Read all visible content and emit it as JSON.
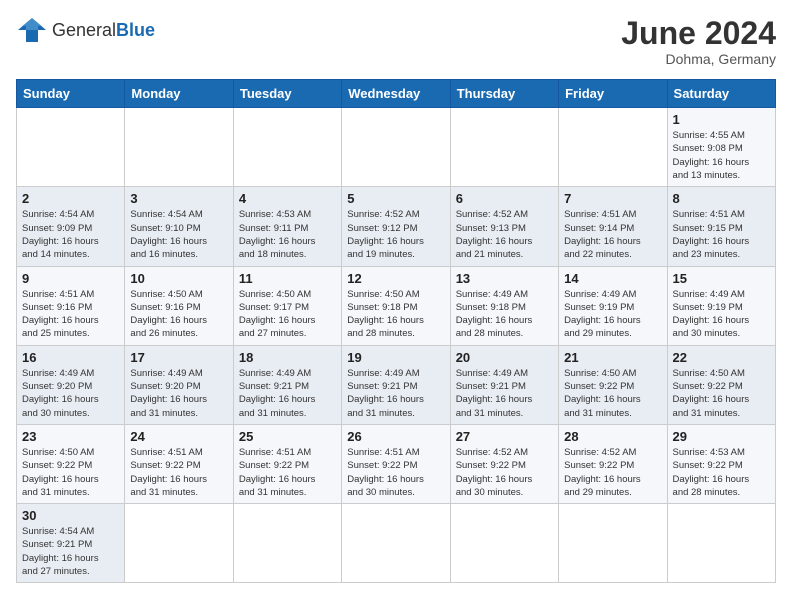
{
  "header": {
    "logo_general": "General",
    "logo_blue": "Blue",
    "month_year": "June 2024",
    "location": "Dohma, Germany"
  },
  "weekdays": [
    "Sunday",
    "Monday",
    "Tuesday",
    "Wednesday",
    "Thursday",
    "Friday",
    "Saturday"
  ],
  "days": [
    {
      "date": "",
      "info": ""
    },
    {
      "date": "",
      "info": ""
    },
    {
      "date": "",
      "info": ""
    },
    {
      "date": "",
      "info": ""
    },
    {
      "date": "",
      "info": ""
    },
    {
      "date": "",
      "info": ""
    },
    {
      "date": "1",
      "info": "Sunrise: 4:55 AM\nSunset: 9:08 PM\nDaylight: 16 hours\nand 13 minutes."
    },
    {
      "date": "2",
      "info": "Sunrise: 4:54 AM\nSunset: 9:09 PM\nDaylight: 16 hours\nand 14 minutes."
    },
    {
      "date": "3",
      "info": "Sunrise: 4:54 AM\nSunset: 9:10 PM\nDaylight: 16 hours\nand 16 minutes."
    },
    {
      "date": "4",
      "info": "Sunrise: 4:53 AM\nSunset: 9:11 PM\nDaylight: 16 hours\nand 18 minutes."
    },
    {
      "date": "5",
      "info": "Sunrise: 4:52 AM\nSunset: 9:12 PM\nDaylight: 16 hours\nand 19 minutes."
    },
    {
      "date": "6",
      "info": "Sunrise: 4:52 AM\nSunset: 9:13 PM\nDaylight: 16 hours\nand 21 minutes."
    },
    {
      "date": "7",
      "info": "Sunrise: 4:51 AM\nSunset: 9:14 PM\nDaylight: 16 hours\nand 22 minutes."
    },
    {
      "date": "8",
      "info": "Sunrise: 4:51 AM\nSunset: 9:15 PM\nDaylight: 16 hours\nand 23 minutes."
    },
    {
      "date": "9",
      "info": "Sunrise: 4:51 AM\nSunset: 9:16 PM\nDaylight: 16 hours\nand 25 minutes."
    },
    {
      "date": "10",
      "info": "Sunrise: 4:50 AM\nSunset: 9:16 PM\nDaylight: 16 hours\nand 26 minutes."
    },
    {
      "date": "11",
      "info": "Sunrise: 4:50 AM\nSunset: 9:17 PM\nDaylight: 16 hours\nand 27 minutes."
    },
    {
      "date": "12",
      "info": "Sunrise: 4:50 AM\nSunset: 9:18 PM\nDaylight: 16 hours\nand 28 minutes."
    },
    {
      "date": "13",
      "info": "Sunrise: 4:49 AM\nSunset: 9:18 PM\nDaylight: 16 hours\nand 28 minutes."
    },
    {
      "date": "14",
      "info": "Sunrise: 4:49 AM\nSunset: 9:19 PM\nDaylight: 16 hours\nand 29 minutes."
    },
    {
      "date": "15",
      "info": "Sunrise: 4:49 AM\nSunset: 9:19 PM\nDaylight: 16 hours\nand 30 minutes."
    },
    {
      "date": "16",
      "info": "Sunrise: 4:49 AM\nSunset: 9:20 PM\nDaylight: 16 hours\nand 30 minutes."
    },
    {
      "date": "17",
      "info": "Sunrise: 4:49 AM\nSunset: 9:20 PM\nDaylight: 16 hours\nand 31 minutes."
    },
    {
      "date": "18",
      "info": "Sunrise: 4:49 AM\nSunset: 9:21 PM\nDaylight: 16 hours\nand 31 minutes."
    },
    {
      "date": "19",
      "info": "Sunrise: 4:49 AM\nSunset: 9:21 PM\nDaylight: 16 hours\nand 31 minutes."
    },
    {
      "date": "20",
      "info": "Sunrise: 4:49 AM\nSunset: 9:21 PM\nDaylight: 16 hours\nand 31 minutes."
    },
    {
      "date": "21",
      "info": "Sunrise: 4:50 AM\nSunset: 9:22 PM\nDaylight: 16 hours\nand 31 minutes."
    },
    {
      "date": "22",
      "info": "Sunrise: 4:50 AM\nSunset: 9:22 PM\nDaylight: 16 hours\nand 31 minutes."
    },
    {
      "date": "23",
      "info": "Sunrise: 4:50 AM\nSunset: 9:22 PM\nDaylight: 16 hours\nand 31 minutes."
    },
    {
      "date": "24",
      "info": "Sunrise: 4:51 AM\nSunset: 9:22 PM\nDaylight: 16 hours\nand 31 minutes."
    },
    {
      "date": "25",
      "info": "Sunrise: 4:51 AM\nSunset: 9:22 PM\nDaylight: 16 hours\nand 31 minutes."
    },
    {
      "date": "26",
      "info": "Sunrise: 4:51 AM\nSunset: 9:22 PM\nDaylight: 16 hours\nand 30 minutes."
    },
    {
      "date": "27",
      "info": "Sunrise: 4:52 AM\nSunset: 9:22 PM\nDaylight: 16 hours\nand 30 minutes."
    },
    {
      "date": "28",
      "info": "Sunrise: 4:52 AM\nSunset: 9:22 PM\nDaylight: 16 hours\nand 29 minutes."
    },
    {
      "date": "29",
      "info": "Sunrise: 4:53 AM\nSunset: 9:22 PM\nDaylight: 16 hours\nand 28 minutes."
    },
    {
      "date": "30",
      "info": "Sunrise: 4:54 AM\nSunset: 9:21 PM\nDaylight: 16 hours\nand 27 minutes."
    },
    {
      "date": "",
      "info": ""
    },
    {
      "date": "",
      "info": ""
    },
    {
      "date": "",
      "info": ""
    },
    {
      "date": "",
      "info": ""
    },
    {
      "date": "",
      "info": ""
    },
    {
      "date": "",
      "info": ""
    }
  ]
}
